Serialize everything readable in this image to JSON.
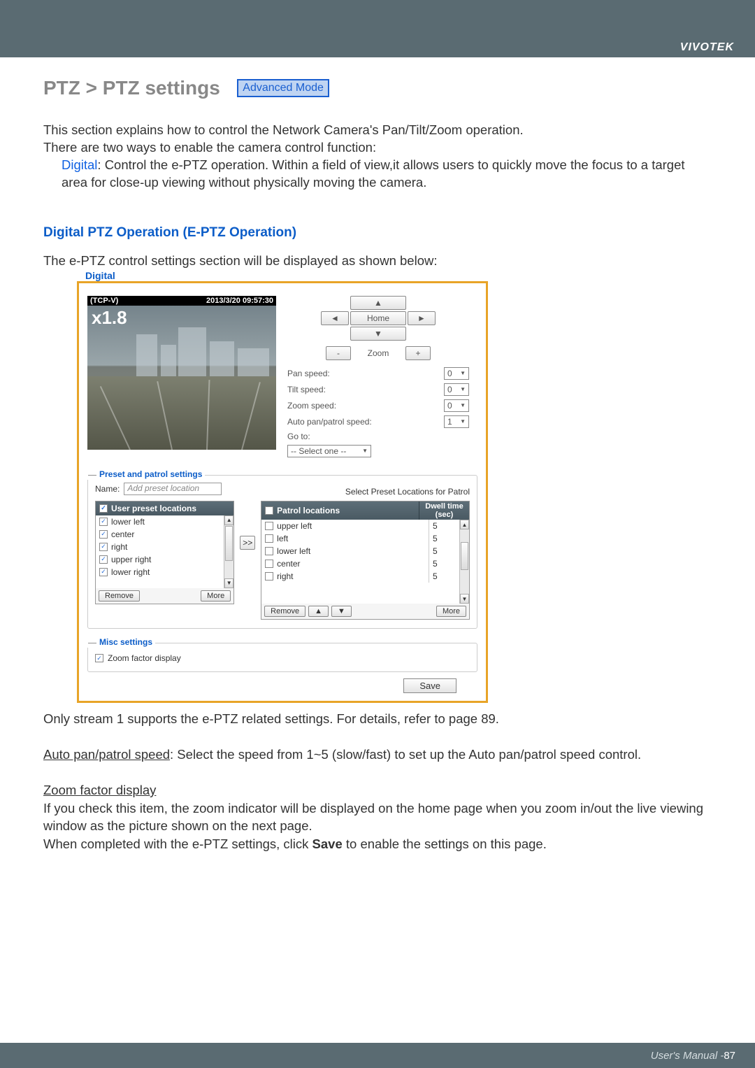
{
  "brand": "VIVOTEK",
  "title": "PTZ > PTZ settings",
  "badge": "Advanced Mode",
  "intro": {
    "l1": "This section explains how to control the Network Camera's Pan/Tilt/Zoom operation.",
    "l2": "There are two ways to enable the camera control function:",
    "digital_label": "Digital",
    "digital_text": ": Control the e-PTZ operation. Within a field of view,it allows users to quickly move the focus to a target area for close-up viewing without physically moving the camera."
  },
  "section_heading": "Digital PTZ Operation (E-PTZ Operation)",
  "sub_intro": "The e-PTZ control settings section will be displayed as shown below:",
  "tab": "Digital",
  "preview": {
    "source": "(TCP-V)",
    "timestamp": "2013/3/20 09:57:30",
    "zoom": "x1.8"
  },
  "controls": {
    "home": "Home",
    "zoom_label": "Zoom",
    "pan": "Pan speed:",
    "tilt": "Tilt speed:",
    "zoomspd": "Zoom speed:",
    "auto": "Auto pan/patrol speed:",
    "goto": "Go to:",
    "goto_val": "-- Select one --",
    "pan_val": "0",
    "tilt_val": "0",
    "zoom_val": "0",
    "auto_val": "1"
  },
  "preset_legend": "Preset and patrol settings",
  "name_label": "Name:",
  "name_placeholder": "Add preset location",
  "select_patrol_label": "Select Preset Locations for Patrol",
  "left_header": "User preset locations",
  "left_items": [
    "lower left",
    "center",
    "right",
    "upper right",
    "lower right"
  ],
  "remove_btn": "Remove",
  "more_btn": "More",
  "right_header_loc": "Patrol locations",
  "right_header_dwell": "Dwell time (sec)",
  "right_items": [
    {
      "name": "upper left",
      "dwell": "5"
    },
    {
      "name": "left",
      "dwell": "5"
    },
    {
      "name": "lower left",
      "dwell": "5"
    },
    {
      "name": "center",
      "dwell": "5"
    },
    {
      "name": "right",
      "dwell": "5"
    }
  ],
  "misc_legend": "Misc settings",
  "misc_zoom": "Zoom factor display",
  "save": "Save",
  "after": {
    "l1": "Only stream 1 supports the e-PTZ related settings. For details, refer to page 89.",
    "l2_a": "Auto pan/patrol speed",
    "l2_b": ": Select the speed from 1~5 (slow/fast) to set up the Auto pan/patrol speed control.",
    "l3": "Zoom factor display",
    "l4": "If you check this item, the zoom indicator will be displayed on the home page when you zoom in/out the live viewing window as the picture shown on the next page.",
    "l5a": "When completed with the e-PTZ settings, click ",
    "l5b": "Save",
    "l5c": " to enable the settings on this page."
  },
  "footer": {
    "label": "User's Manual - ",
    "page": "87"
  }
}
